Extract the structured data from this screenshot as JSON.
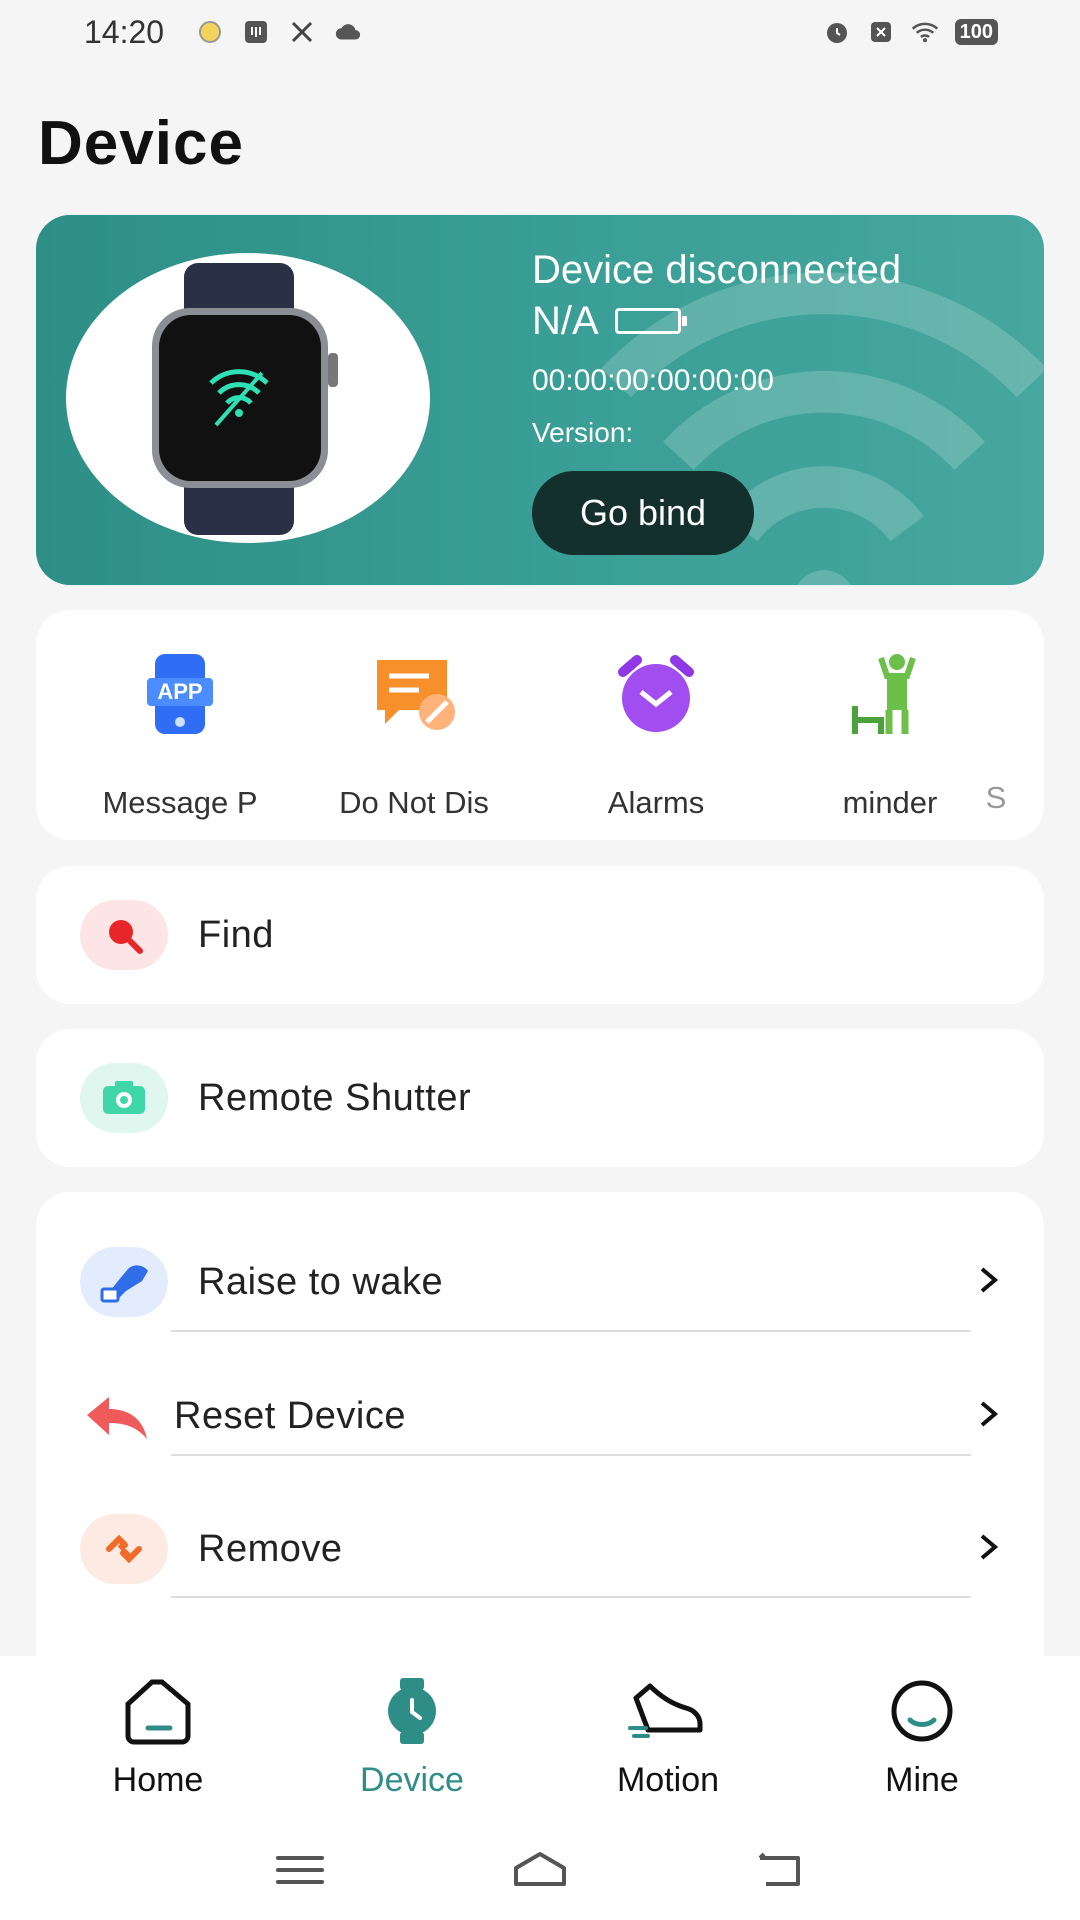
{
  "status_bar": {
    "time": "14:20",
    "battery": "100"
  },
  "page": {
    "title": "Device"
  },
  "device": {
    "status": "Device disconnected",
    "battery_text": "N/A",
    "mac": "00:00:00:00:00:00",
    "version_label": "Version:",
    "bind_button": "Go bind"
  },
  "quick_functions": [
    {
      "label": "Message P",
      "icon": "app-message-icon"
    },
    {
      "label": "Do Not Dis",
      "icon": "do-not-disturb-icon"
    },
    {
      "label": "Alarms",
      "icon": "alarm-clock-icon"
    },
    {
      "label": "minder",
      "icon": "sedentary-reminder-icon"
    },
    {
      "label": "S",
      "icon": "more-icon"
    }
  ],
  "list": {
    "find": "Find",
    "remote_shutter": "Remote Shutter",
    "raise_to_wake": "Raise to wake",
    "reset_device": "Reset Device",
    "remove": "Remove"
  },
  "nav": {
    "home": "Home",
    "device": "Device",
    "motion": "Motion",
    "mine": "Mine"
  },
  "colors": {
    "accent": "#2e8e87",
    "card": "#3a9f96"
  }
}
